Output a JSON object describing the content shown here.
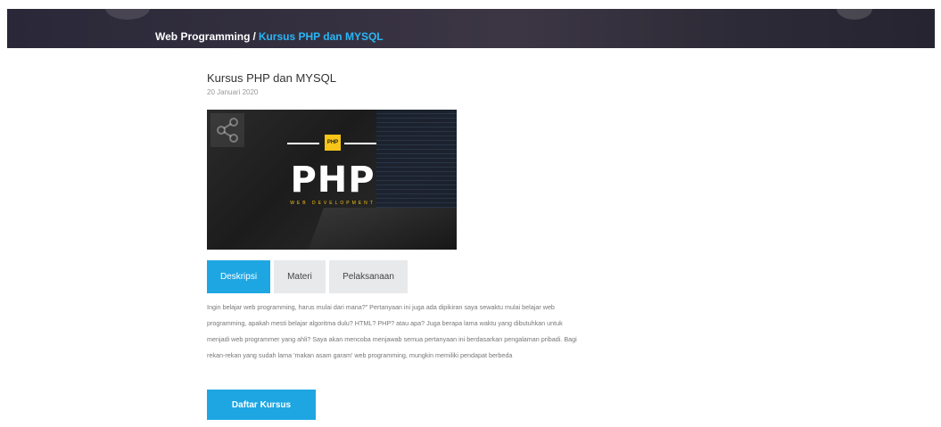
{
  "breadcrumb": {
    "parent": "Web Programming",
    "separator": "/",
    "current": "Kursus PHP dan MYSQL"
  },
  "course": {
    "title": "Kursus PHP dan MYSQL",
    "date": "20 Januari 2020",
    "image": {
      "badge": "PHP",
      "heading": "PHP",
      "subtitle": "WEB DEVELOPMENT"
    }
  },
  "tabs": [
    {
      "label": "Deskripsi",
      "active": true
    },
    {
      "label": "Materi",
      "active": false
    },
    {
      "label": "Pelaksanaan",
      "active": false
    }
  ],
  "description": "Ingin belajar web programming, harus mulai dari mana?” Pertanyaan ini juga ada dipikiran saya sewaktu mulai belajar web programming, apakah mesti belajar algoritma dulu? HTML? PHP? atau apa? Juga berapa lama waktu yang dibutuhkan untuk menjadi web programmer yang ahli? Saya akan mencoba menjawab semua pertanyaan ini berdasarkan pengalaman pribadi. Bagi rekan-rekan yang sudah lama 'makan asam garam' web programming, mungkin memiliki pendapat berbeda",
  "cta": {
    "label": "Daftar Kursus"
  },
  "colors": {
    "accent": "#1ea6e3",
    "breadcrumb_current": "#29b6f6",
    "tab_inactive": "#e7e9eb",
    "php_yellow": "#f5c518"
  }
}
